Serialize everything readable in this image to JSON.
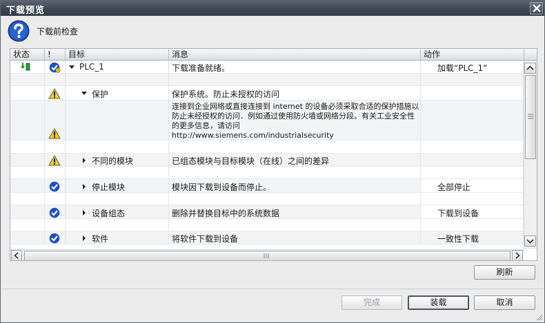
{
  "window": {
    "title": "下载预览"
  },
  "header": {
    "text": "下载前检查"
  },
  "columns": [
    "状态",
    "!",
    "目标",
    "消息",
    "动作"
  ],
  "rows": [
    {
      "target": "PLC_1",
      "message": "下载准备就绪。",
      "action": "加载“PLC_1”",
      "status_icon": "download-status-icon",
      "check_icon": "ok-icon",
      "expander": "expanded"
    },
    {
      "target": "",
      "message": "",
      "action": ""
    },
    {
      "target": "保护",
      "message": "保护系统。防止未授权的访问",
      "action": "",
      "check_icon": "warning-icon",
      "expander": "expanded"
    },
    {
      "target": "",
      "message": "连接到企业网络或直接连接到 internet 的设备必须采取合适的保护措施以防止未经授权的访问．例如通过使用防火墙或网络分段。有关工业安全性的更多信息，请访问\nhttp://www.siemens.com/industrialsecurity",
      "action": "",
      "check_icon": "warning-icon"
    },
    {
      "target": "",
      "message": "",
      "action": ""
    },
    {
      "target": "不同的模块",
      "message": "已组态模块与目标模块（在线）之间的差异",
      "action": "",
      "check_icon": "warning-icon",
      "expander": "collapsed"
    },
    {
      "target": "",
      "message": "",
      "action": ""
    },
    {
      "target": "停止模块",
      "message": "模块因下载到设备而停止。",
      "action": "全部停止",
      "check_icon": "ok-icon",
      "expander": "collapsed"
    },
    {
      "target": "",
      "message": "",
      "action": ""
    },
    {
      "target": "设备组态",
      "message": "删除并替换目标中的系统数据",
      "action": "下载到设备",
      "check_icon": "ok-icon",
      "expander": "collapsed"
    },
    {
      "target": "",
      "message": "",
      "action": ""
    },
    {
      "target": "软件",
      "message": "将软件下载到设备",
      "action": "一致性下载",
      "check_icon": "ok-icon",
      "expander": "collapsed"
    }
  ],
  "buttons": {
    "refresh": "刷新",
    "finish": "完成",
    "load": "装载",
    "cancel": "取消"
  },
  "colors": {
    "titlebar": "#3d4651",
    "ok": "#1e50c8",
    "warning": "#f5d21a",
    "row_alt": "#f3f4f5"
  }
}
